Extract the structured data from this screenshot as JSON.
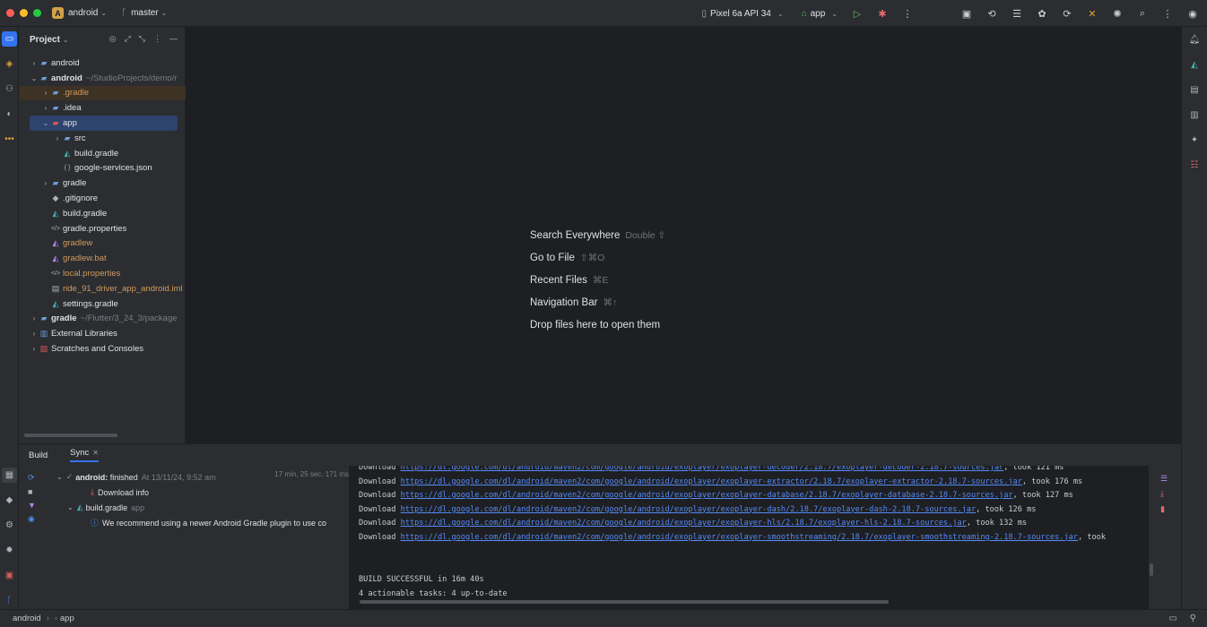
{
  "titlebar": {
    "project_badge": "A",
    "project": "android",
    "branch": "master",
    "device": "Pixel 6a API 34",
    "run_config": "app"
  },
  "project_panel": {
    "title": "Project",
    "tree": [
      {
        "label": "android",
        "hint": "",
        "depth": 0,
        "arrow": "›",
        "icon": "folder-icon"
      },
      {
        "label": "android",
        "hint": "~/StudioProjects/demo/r",
        "depth": 0,
        "arrow": "⌄",
        "icon": "folder-icon",
        "bold": true
      },
      {
        "label": ".gradle",
        "hint": "",
        "depth": 1,
        "arrow": "›",
        "icon": "folder-icon",
        "orange": true,
        "hl": true
      },
      {
        "label": ".idea",
        "hint": "",
        "depth": 1,
        "arrow": "›",
        "icon": "folder-icon"
      },
      {
        "label": "app",
        "hint": "",
        "depth": 1,
        "arrow": "⌄",
        "icon": "module-icon",
        "selected": true
      },
      {
        "label": "src",
        "hint": "",
        "depth": 2,
        "arrow": "›",
        "icon": "folder-icon"
      },
      {
        "label": "build.gradle",
        "hint": "",
        "depth": 2,
        "arrow": "",
        "icon": "gradle-icon"
      },
      {
        "label": "google-services.json",
        "hint": "",
        "depth": 2,
        "arrow": "",
        "icon": "json-icon"
      },
      {
        "label": "gradle",
        "hint": "",
        "depth": 1,
        "arrow": "›",
        "icon": "folder-icon"
      },
      {
        "label": ".gitignore",
        "hint": "",
        "depth": 1,
        "arrow": "",
        "icon": "gitignore-icon"
      },
      {
        "label": "build.gradle",
        "hint": "",
        "depth": 1,
        "arrow": "",
        "icon": "gradle-icon"
      },
      {
        "label": "gradle.properties",
        "hint": "",
        "depth": 1,
        "arrow": "",
        "icon": "properties-icon"
      },
      {
        "label": "gradlew",
        "hint": "",
        "depth": 1,
        "arrow": "",
        "icon": "script-icon",
        "orange": true
      },
      {
        "label": "gradlew.bat",
        "hint": "",
        "depth": 1,
        "arrow": "",
        "icon": "script-icon",
        "orange": true
      },
      {
        "label": "local.properties",
        "hint": "",
        "depth": 1,
        "arrow": "",
        "icon": "properties-icon",
        "orange": true
      },
      {
        "label": "ride_91_driver_app_android.iml",
        "hint": "",
        "depth": 1,
        "arrow": "",
        "icon": "iml-icon",
        "orange": true
      },
      {
        "label": "settings.gradle",
        "hint": "",
        "depth": 1,
        "arrow": "",
        "icon": "gradle-icon"
      },
      {
        "label": "gradle",
        "hint": "~/Flutter/3_24_3/package",
        "depth": 0,
        "arrow": "›",
        "icon": "folder-icon",
        "bold": true
      },
      {
        "label": "External Libraries",
        "hint": "",
        "depth": 0,
        "arrow": "›",
        "icon": "library-icon"
      },
      {
        "label": "Scratches and Consoles",
        "hint": "",
        "depth": 0,
        "arrow": "›",
        "icon": "scratches-icon"
      }
    ]
  },
  "editor": {
    "hints": [
      {
        "label": "Search Everywhere",
        "key": "Double ⇧"
      },
      {
        "label": "Go to File",
        "key": "⇧⌘O"
      },
      {
        "label": "Recent Files",
        "key": "⌘E"
      },
      {
        "label": "Navigation Bar",
        "key": "⌘↑"
      },
      {
        "label": "Drop files here to open them",
        "key": ""
      }
    ]
  },
  "build_panel": {
    "tab_build": "Build",
    "tab_sync": "Sync",
    "tree": {
      "root_label": "android:",
      "root_status": "finished",
      "root_time": "At 13/11/24, 9:52 am",
      "duration": "17 min, 25 sec, 171 ms",
      "download_info": "Download info",
      "build_gradle": "build.gradle",
      "build_gradle_module": "app",
      "recommend": "We recommend using a newer Android Gradle plugin to use co"
    },
    "console": [
      {
        "prefix": "Download",
        "url": "https://dl.google.com/dl/android/maven2/com/google/android/exoplayer/exoplayer-decoder/2.18.7/exoplayer-decoder-2.18.7-sources.jar",
        "suffix": ", took 121 ms"
      },
      {
        "prefix": "Download",
        "url": "https://dl.google.com/dl/android/maven2/com/google/android/exoplayer/exoplayer-extractor/2.18.7/exoplayer-extractor-2.18.7-sources.jar",
        "suffix": ", took 176 ms"
      },
      {
        "prefix": "Download",
        "url": "https://dl.google.com/dl/android/maven2/com/google/android/exoplayer/exoplayer-database/2.18.7/exoplayer-database-2.18.7-sources.jar",
        "suffix": ", took 127 ms"
      },
      {
        "prefix": "Download",
        "url": "https://dl.google.com/dl/android/maven2/com/google/android/exoplayer/exoplayer-dash/2.18.7/exoplayer-dash-2.18.7-sources.jar",
        "suffix": ", took 126 ms"
      },
      {
        "prefix": "Download",
        "url": "https://dl.google.com/dl/android/maven2/com/google/android/exoplayer/exoplayer-hls/2.18.7/exoplayer-hls-2.18.7-sources.jar",
        "suffix": ", took 132 ms"
      },
      {
        "prefix": "Download",
        "url": "https://dl.google.com/dl/android/maven2/com/google/android/exoplayer/exoplayer-smoothstreaming/2.18.7/exoplayer-smoothstreaming-2.18.7-sources.jar",
        "suffix": ", took"
      }
    ],
    "build_result": "BUILD SUCCESSFUL in 16m 40s",
    "actionable": "4 actionable tasks: 4 up-to-date"
  },
  "statusbar": {
    "crumb1": "android",
    "crumb2": "app"
  },
  "colors": {
    "accent": "#3574f0",
    "background": "#1e1f22",
    "panel": "#2b2d30",
    "link": "#548af7"
  }
}
